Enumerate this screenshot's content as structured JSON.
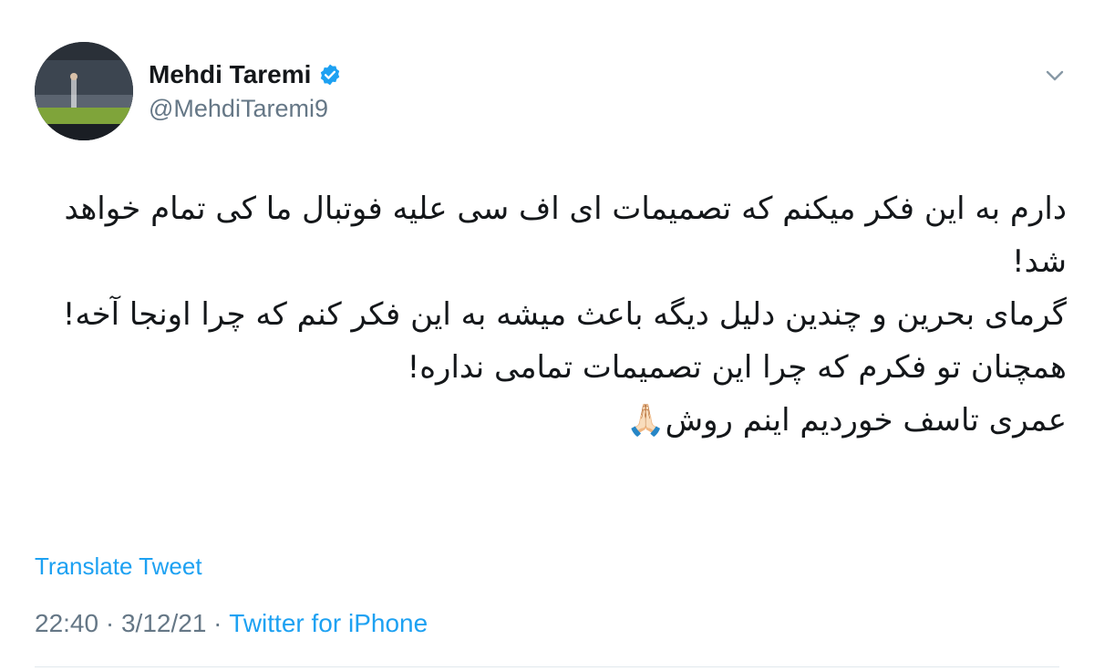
{
  "author": {
    "display_name": "Mehdi Taremi",
    "handle": "@MehdiTaremi9",
    "verified": true
  },
  "tweet": {
    "lines": [
      "دارم به این فکر میکنم که تصمیمات ای اف سی علیه فوتبال ما کی تمام خواهد شد!",
      "گرمای بحرین و چندین دلیل دیگه باعث میشه به این فکر کنم که چرا اونجا آخه!",
      "همچنان تو فکرم که چرا این تصمیمات تمامی نداره!",
      "عمری تاسف خوردیم اینم روش🙏🏻"
    ]
  },
  "translate_label": "Translate Tweet",
  "meta": {
    "time": "22:40",
    "separator1": " · ",
    "date": "3/12/21",
    "separator2": " · ",
    "source": "Twitter for iPhone"
  },
  "colors": {
    "link": "#1da1f2",
    "secondary_text": "#657786",
    "verified_badge": "#1da1f2"
  },
  "icons": {
    "verified": "verified-badge-icon",
    "caret": "chevron-down-icon"
  }
}
